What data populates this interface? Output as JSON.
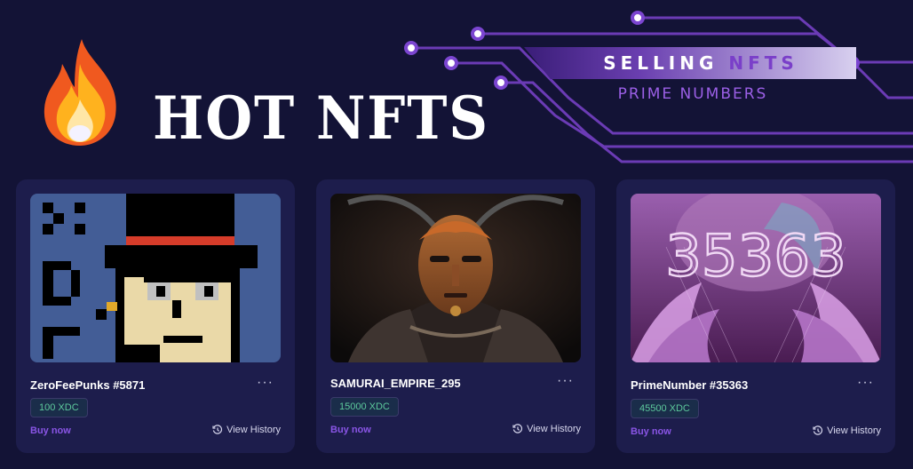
{
  "header": {
    "title": "HOT NFTS",
    "banner_main": "SELLING",
    "banner_accent": "NFTS",
    "banner_sub": "PRIME NUMBERS"
  },
  "icons": {
    "flame": "fire-emoji-icon",
    "more": "more-horizontal-icon",
    "history": "history-clock-icon"
  },
  "colors": {
    "background": "#131336",
    "card": "#1d1d4c",
    "accent_purple": "#8a55e6",
    "price_green": "#5dc99c"
  },
  "cards": [
    {
      "name": "ZeroFeePunks #5871",
      "price": "100 XDC",
      "buy_label": "Buy now",
      "more_label": "···",
      "history_label": "View History"
    },
    {
      "name": "SAMURAI_EMPIRE_295",
      "price": "15000 XDC",
      "buy_label": "Buy now",
      "more_label": "···",
      "history_label": "View History"
    },
    {
      "name": "PrimeNumber #35363",
      "price": "45500 XDC",
      "buy_label": "Buy now",
      "more_label": "···",
      "history_label": "View History",
      "image_text": "35363"
    }
  ]
}
